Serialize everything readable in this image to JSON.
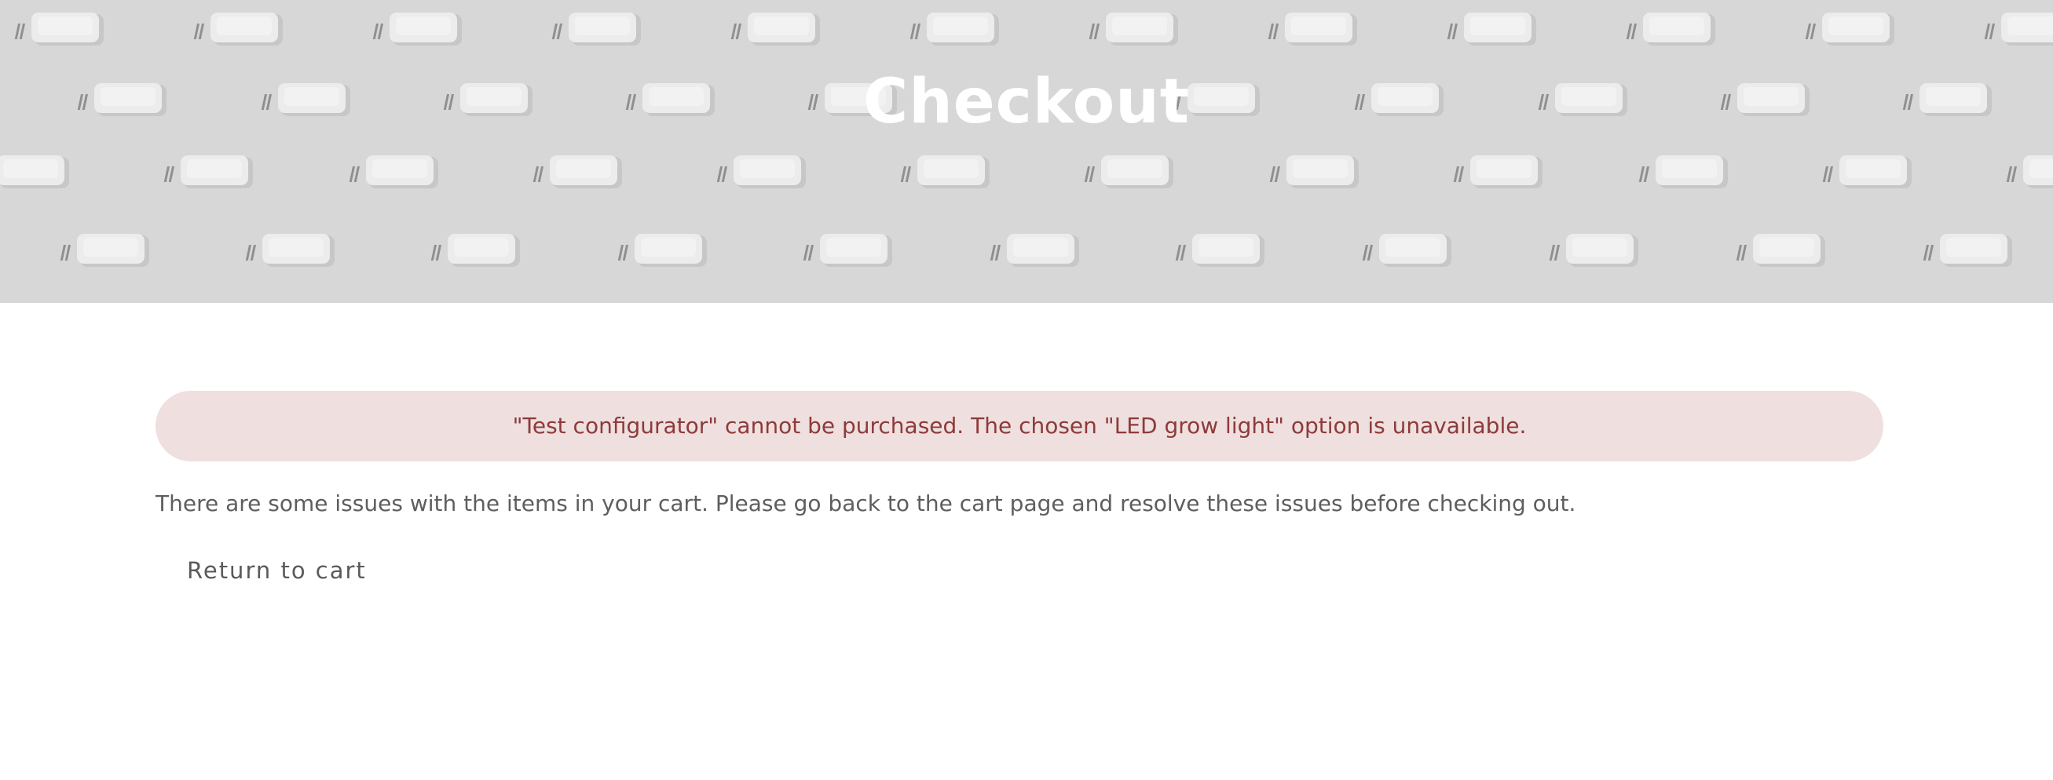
{
  "header": {
    "title": "Checkout",
    "background_color": "#d7d7d7",
    "pattern": "embossed-led-chips"
  },
  "error_notice": {
    "message": "\"Test configurator\" cannot be purchased. The chosen \"LED grow light\" option is unavailable.",
    "background_color": "#efdfdf",
    "text_color": "#8e3a3a"
  },
  "cart_issues": {
    "message": "There are some issues with the items in your cart. Please go back to the cart page and resolve these issues before checking out."
  },
  "actions": {
    "return_to_cart_label": "Return to cart"
  }
}
